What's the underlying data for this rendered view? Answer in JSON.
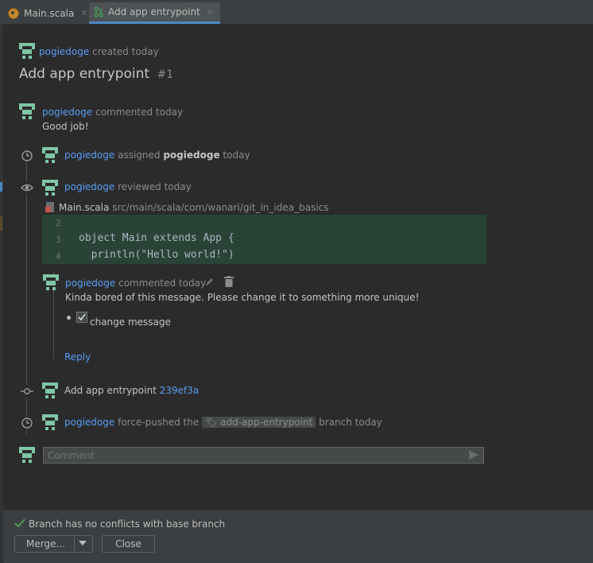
{
  "tabs": [
    {
      "label": "Main.scala",
      "active": false
    },
    {
      "label": "Add app entrypoint",
      "active": true
    }
  ],
  "header": {
    "author": "pogiedoge",
    "created_text": "created today",
    "title": "Add app entrypoint",
    "number": "#1"
  },
  "timeline": {
    "comment1": {
      "author": "pogiedoge",
      "action": "commented today",
      "body": "Good job!"
    },
    "assigned": {
      "author": "pogiedoge",
      "action": "assigned",
      "assignee": "pogiedoge",
      "when": "today"
    },
    "reviewed": {
      "author": "pogiedoge",
      "action": "reviewed today"
    },
    "file": {
      "name": "Main.scala",
      "path": "src/main/scala/com/wanari/git_in_idea_basics"
    },
    "code_lines": [
      {
        "num": "2",
        "text": ""
      },
      {
        "num": "3",
        "text": "object Main extends App {"
      },
      {
        "num": "4",
        "text": "  println(\"Hello world!\")"
      }
    ],
    "review_comment": {
      "author": "pogiedoge",
      "action": "commented today",
      "body": "Kinda bored of this message. Please change it to something more unique!",
      "task": "change message",
      "reply": "Reply"
    },
    "commit": {
      "message": "Add app entrypoint",
      "hash": "239ef3a"
    },
    "force_push": {
      "author": "pogiedoge",
      "action": "force-pushed the",
      "branch": "add-app-entrypoint",
      "suffix": "branch today"
    }
  },
  "comment_input": {
    "placeholder": "Comment"
  },
  "footer": {
    "status": "Branch has no conflicts with base branch",
    "merge_label": "Merge...",
    "close_label": "Close"
  },
  "colors": {
    "accent": "#589df6",
    "success": "#499c54",
    "code_bg": "#294436"
  }
}
